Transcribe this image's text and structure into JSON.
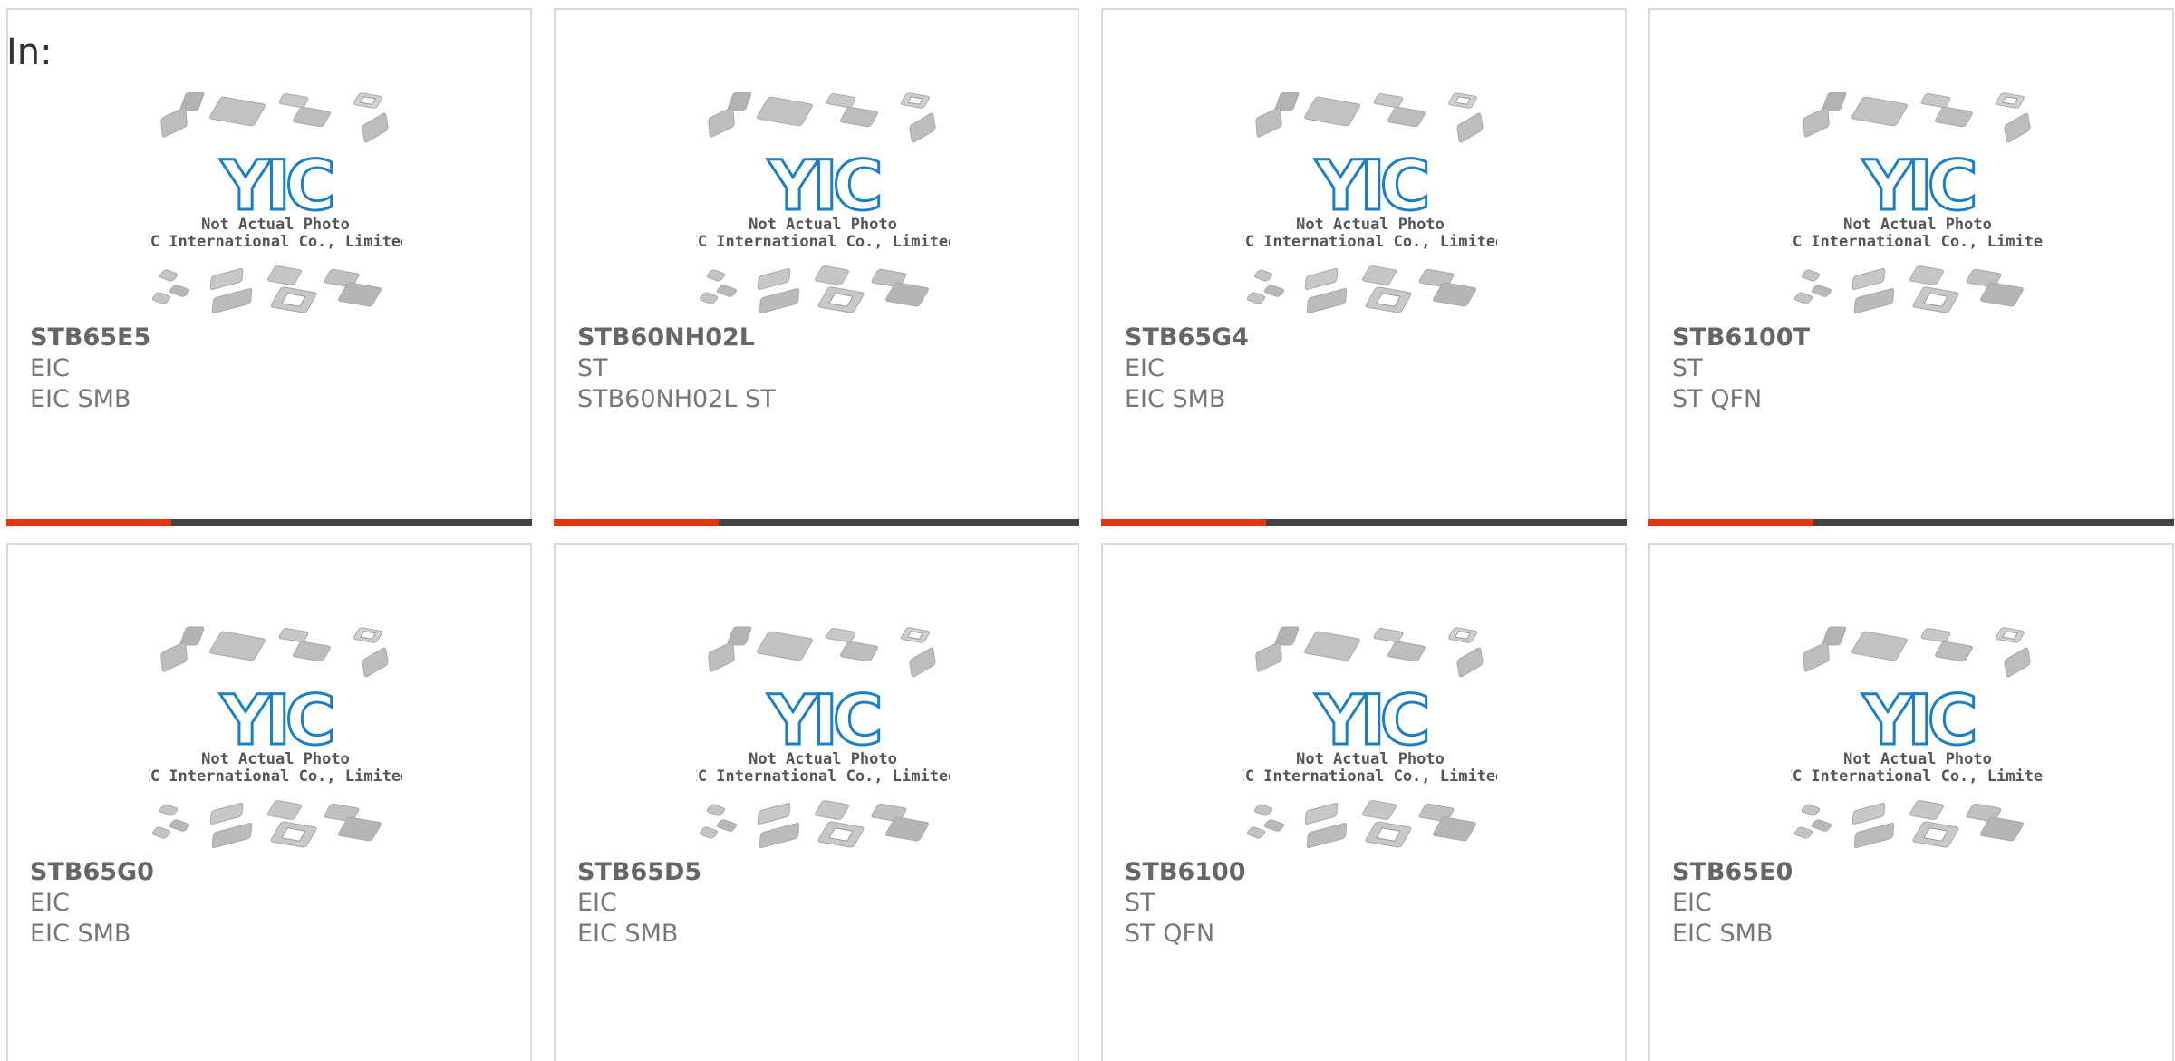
{
  "page": {
    "label": "In:"
  },
  "thumbnail": {
    "caption_line1": "Not Actual Photo",
    "caption_line2": "YIC International Co., Limited.",
    "logo_text": "YIC"
  },
  "colors": {
    "accent_bar": "#e63312",
    "bar_dark": "#444444",
    "logo_blue": "#1b7fc4",
    "text_gray": "#777777"
  },
  "products": [
    {
      "part": "STB65E5",
      "maker": "EIC",
      "package": "EIC SMB"
    },
    {
      "part": "STB60NH02L",
      "maker": "ST",
      "package": "STB60NH02L ST"
    },
    {
      "part": "STB65G4",
      "maker": "EIC",
      "package": "EIC SMB"
    },
    {
      "part": "STB6100T",
      "maker": "ST",
      "package": "ST QFN"
    },
    {
      "part": "STB65G0",
      "maker": "EIC",
      "package": "EIC SMB"
    },
    {
      "part": "STB65D5",
      "maker": "EIC",
      "package": "EIC SMB"
    },
    {
      "part": "STB6100",
      "maker": "ST",
      "package": "ST QFN"
    },
    {
      "part": "STB65E0",
      "maker": "EIC",
      "package": "EIC SMB"
    }
  ]
}
